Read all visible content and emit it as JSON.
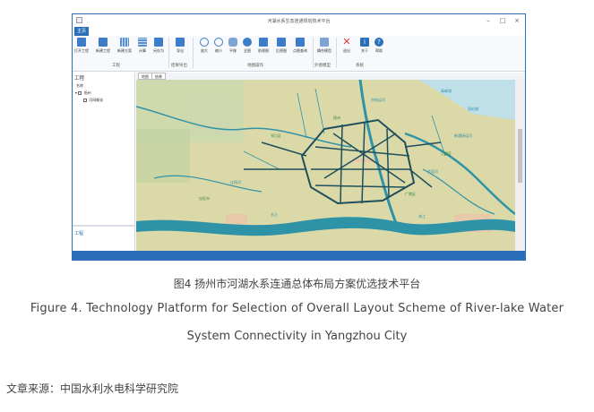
{
  "window": {
    "title": "河湖水系生态连通规划技术平台",
    "controls": {
      "minimize": "–",
      "maximize": "□",
      "close": "×"
    }
  },
  "menu": {
    "active_tab": "主页"
  },
  "ribbon": {
    "buttons": [
      {
        "label": "打开工程",
        "icon": "folder-open-icon",
        "color": "#3d7cc9"
      },
      {
        "label": "新建工程",
        "icon": "folder-new-icon",
        "color": "#3d7cc9"
      },
      {
        "label": "新建方案",
        "icon": "grid-new-icon",
        "color": "#5a8fd0"
      },
      {
        "label": "计算",
        "icon": "grid-calc-icon",
        "color": "#5a8fd0"
      },
      {
        "label": "另存为",
        "icon": "save-as-icon",
        "color": "#3d7cc9"
      },
      {
        "label": "导出",
        "icon": "export-icon",
        "color": "#3d7cc9"
      },
      {
        "label": "放大",
        "icon": "zoom-in-icon",
        "color": "#3d7cc9"
      },
      {
        "label": "缩小",
        "icon": "zoom-out-icon",
        "color": "#3d7cc9"
      },
      {
        "label": "平移",
        "icon": "pan-hand-icon",
        "color": "#7ea4d6"
      },
      {
        "label": "全图",
        "icon": "globe-icon",
        "color": "#3d7cc9"
      },
      {
        "label": "前视图",
        "icon": "back-arrow-icon",
        "color": "#3d7cc9"
      },
      {
        "label": "后视图",
        "icon": "forward-arrow-icon",
        "color": "#3d7cc9"
      },
      {
        "label": "点图查询",
        "icon": "point-query-icon",
        "color": "#3d7cc9"
      },
      {
        "label": "耦合模型",
        "icon": "coupling-model-icon",
        "color": "#7ea4d6"
      },
      {
        "label": "退出",
        "icon": "close-x-icon",
        "color": "#d63b3b"
      },
      {
        "label": "关于",
        "icon": "info-icon",
        "color": "#2a6fb8"
      },
      {
        "label": "帮助",
        "icon": "help-icon",
        "color": "#2a6fb8"
      }
    ],
    "groups": [
      "工程",
      "结果导出",
      "地图操作",
      "外接模型",
      "系统"
    ]
  },
  "left_panel": {
    "title": "工程",
    "column_header": "名称",
    "tree": [
      {
        "label": "扬州",
        "level": 1,
        "checked": true
      },
      {
        "label": "河网概化",
        "level": 2,
        "checked": true
      }
    ],
    "bottom_tab": "工程"
  },
  "view_tabs": [
    "地图",
    "结果"
  ],
  "map_labels": [
    {
      "text": "扬州",
      "color": "#2f8a3a"
    },
    {
      "text": "江都区",
      "color": "#2f8a3a"
    },
    {
      "text": "仪征市",
      "color": "#2f8a3a"
    },
    {
      "text": "邗江区",
      "color": "#2f8a3a"
    },
    {
      "text": "广陵区",
      "color": "#2f8a3a"
    },
    {
      "text": "长江",
      "color": "#2a8fa8"
    },
    {
      "text": "京杭运河",
      "color": "#2a8fa8"
    },
    {
      "text": "芒稻河",
      "color": "#2a8fa8"
    },
    {
      "text": "新通扬运河",
      "color": "#2a8fa8"
    },
    {
      "text": "夹江",
      "color": "#2a8fa8"
    },
    {
      "text": "高邮湖",
      "color": "#2a8fa8"
    },
    {
      "text": "邵伯湖",
      "color": "#2a8fa8"
    },
    {
      "text": "仪扬河",
      "color": "#2a8fa8"
    }
  ],
  "caption": {
    "cn": "图4 扬州市河湖水系连通总体布局方案优选技术平台",
    "en_line1": "Figure 4. Technology Platform for Selection of Overall Layout Scheme of River-lake Water",
    "en_line2": "System Connectivity in Yangzhou City"
  },
  "source": "文章来源：中国水利水电科学研究院",
  "colors": {
    "accent": "#2a6fb8",
    "map_land": "#dcd9a8",
    "map_water": "#2f93a8",
    "map_network": "#1f4f5c"
  }
}
